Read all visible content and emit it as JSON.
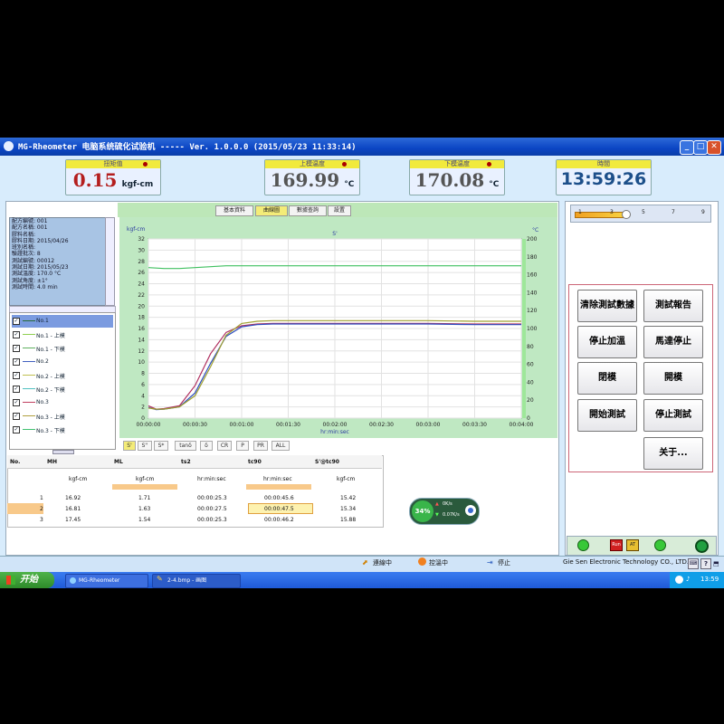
{
  "window": {
    "title": "MG-Rheometer 电脑系统硫化试验机 ----- Ver. 1.0.0.0 (2015/05/23 11:33:14)",
    "controls": [
      "_",
      "□",
      "✕"
    ]
  },
  "gauges": [
    {
      "label": "扭矩值",
      "value": "0.15",
      "unit": "kgf-cm"
    },
    {
      "label": "上模温度",
      "value": "169.99",
      "unit": "°C"
    },
    {
      "label": "下模温度",
      "value": "170.08",
      "unit": "°C"
    },
    {
      "label": "時間",
      "value": "13:59:26",
      "unit": ""
    }
  ],
  "tabs": [
    "基本資料",
    "曲線圖",
    "數據查詢",
    "設置"
  ],
  "info_lines": [
    "配方編號: 001",
    "配方名稱: 001",
    "膠料名稱:",
    "膠料日期: 2015/04/26",
    "班別名稱:",
    "驗證批次: 8",
    "測試編號: 00012",
    "測試日期: 2015/05/23",
    "測試溫度: 170.0 °C",
    "測試角度: ±1°",
    "測試時間: 4.0 min"
  ],
  "series_list": [
    {
      "label": "No.1",
      "color": "#2a6a3a",
      "checked": "✓"
    },
    {
      "label": "No.1 - 上模",
      "color": "#90d050",
      "checked": "✓"
    },
    {
      "label": "No.1 - 下模",
      "color": "#60b060",
      "checked": "✓"
    },
    {
      "label": "No.2",
      "color": "#4060c0",
      "checked": "✓"
    },
    {
      "label": "No.2 - 上模",
      "color": "#c0c050",
      "checked": "✓"
    },
    {
      "label": "No.2 - 下模",
      "color": "#50c0c0",
      "checked": "✓"
    },
    {
      "label": "No.3",
      "color": "#c04060",
      "checked": "✓"
    },
    {
      "label": "No.3 - 上模",
      "color": "#b0a040",
      "checked": "✓"
    },
    {
      "label": "No.3 - 下模",
      "color": "#40c070",
      "checked": "✓"
    }
  ],
  "chart_data": {
    "type": "line",
    "title": "S'",
    "ylabel": "kgf-cm",
    "y2label": "°C",
    "xlabel": "hr:min:sec",
    "x_ticks": [
      "00:00:00",
      "00:00:30",
      "00:01:00",
      "00:01:30",
      "00:02:00",
      "00:02:30",
      "00:03:00",
      "00:03:30",
      "00:04:00"
    ],
    "y_ticks": [
      0,
      2,
      4,
      6,
      8,
      10,
      12,
      14,
      16,
      18,
      20,
      22,
      24,
      26,
      28,
      30,
      32
    ],
    "y2_ticks": [
      0,
      20,
      40,
      60,
      80,
      100,
      120,
      140,
      160,
      180,
      200
    ],
    "xlim": [
      0,
      240
    ],
    "ylim": [
      0,
      32
    ],
    "y2lim": [
      0,
      200
    ],
    "grid": true,
    "series": [
      {
        "color": "#b03060",
        "axis": "y",
        "x": [
          0,
          5,
          10,
          20,
          30,
          40,
          50,
          60,
          70,
          80,
          90,
          100,
          120,
          150,
          180,
          210,
          240
        ],
        "y": [
          2.2,
          1.6,
          1.7,
          2.2,
          5.8,
          11.5,
          15.3,
          16.5,
          16.8,
          16.9,
          16.9,
          16.9,
          16.9,
          16.9,
          16.9,
          16.8,
          16.8
        ]
      },
      {
        "color": "#3050c0",
        "axis": "y",
        "x": [
          0,
          5,
          10,
          20,
          30,
          40,
          50,
          60,
          70,
          80,
          90,
          100,
          120,
          150,
          180,
          210,
          240
        ],
        "y": [
          1.9,
          1.5,
          1.6,
          2.0,
          4.5,
          9.8,
          14.6,
          16.3,
          16.7,
          16.8,
          16.8,
          16.8,
          16.8,
          16.8,
          16.8,
          16.7,
          16.7
        ]
      },
      {
        "color": "#a0a030",
        "axis": "y",
        "x": [
          0,
          5,
          10,
          20,
          30,
          40,
          50,
          60,
          70,
          80,
          90,
          100,
          120,
          150,
          180,
          210,
          240
        ],
        "y": [
          1.8,
          1.6,
          1.6,
          2.0,
          4.0,
          9.2,
          14.8,
          16.9,
          17.3,
          17.4,
          17.4,
          17.4,
          17.4,
          17.4,
          17.4,
          17.3,
          17.3
        ]
      },
      {
        "color": "#40c060",
        "axis": "y2",
        "x": [
          0,
          10,
          20,
          30,
          50,
          60,
          90,
          120,
          150,
          180,
          210,
          240
        ],
        "y": [
          168,
          167,
          167,
          168,
          170,
          170,
          170,
          170,
          170,
          170,
          170,
          170
        ]
      }
    ]
  },
  "chart_tabs": [
    "S'",
    "S''",
    "S*",
    "tanδ",
    "δ",
    "CR",
    "P",
    "PR",
    "ALL"
  ],
  "table": {
    "headers": [
      "No.",
      "MH",
      "ML",
      "ts2",
      "tc90",
      "S'@tc90"
    ],
    "units": [
      "",
      "kgf-cm",
      "kgf-cm",
      "hr:min:sec",
      "hr:min:sec",
      "kgf-cm"
    ],
    "rows": [
      [
        "1",
        "16.92",
        "1.71",
        "00:00:25.3",
        "00:00:45.6",
        "15.42"
      ],
      [
        "2",
        "16.81",
        "1.63",
        "00:00:27.5",
        "00:00:47.5",
        "15.34"
      ],
      [
        "3",
        "17.45",
        "1.54",
        "00:00:25.3",
        "00:00:46.2",
        "15.88"
      ]
    ]
  },
  "mini_widget": {
    "percent": "34%",
    "up": "0K/s",
    "down": "0.07K/s"
  },
  "slider_labels": [
    "1",
    "3",
    "5",
    "7",
    "9"
  ],
  "buttons": [
    "清除測試數據",
    "測試報告",
    "停止加溫",
    "馬達停止",
    "閉模",
    "開模",
    "開始測試",
    "停止測試",
    "关于..."
  ],
  "indicators": [
    "Run",
    "AT"
  ],
  "status": {
    "items": [
      "連線中",
      "控溫中",
      "停止"
    ],
    "company": "Gie Sen Electronic Technology CO., LTD."
  },
  "taskbar": {
    "start": "开始",
    "tasks": [
      "MG-Rheometer",
      "2-4.bmp - 画图"
    ],
    "clock": "13:59"
  }
}
